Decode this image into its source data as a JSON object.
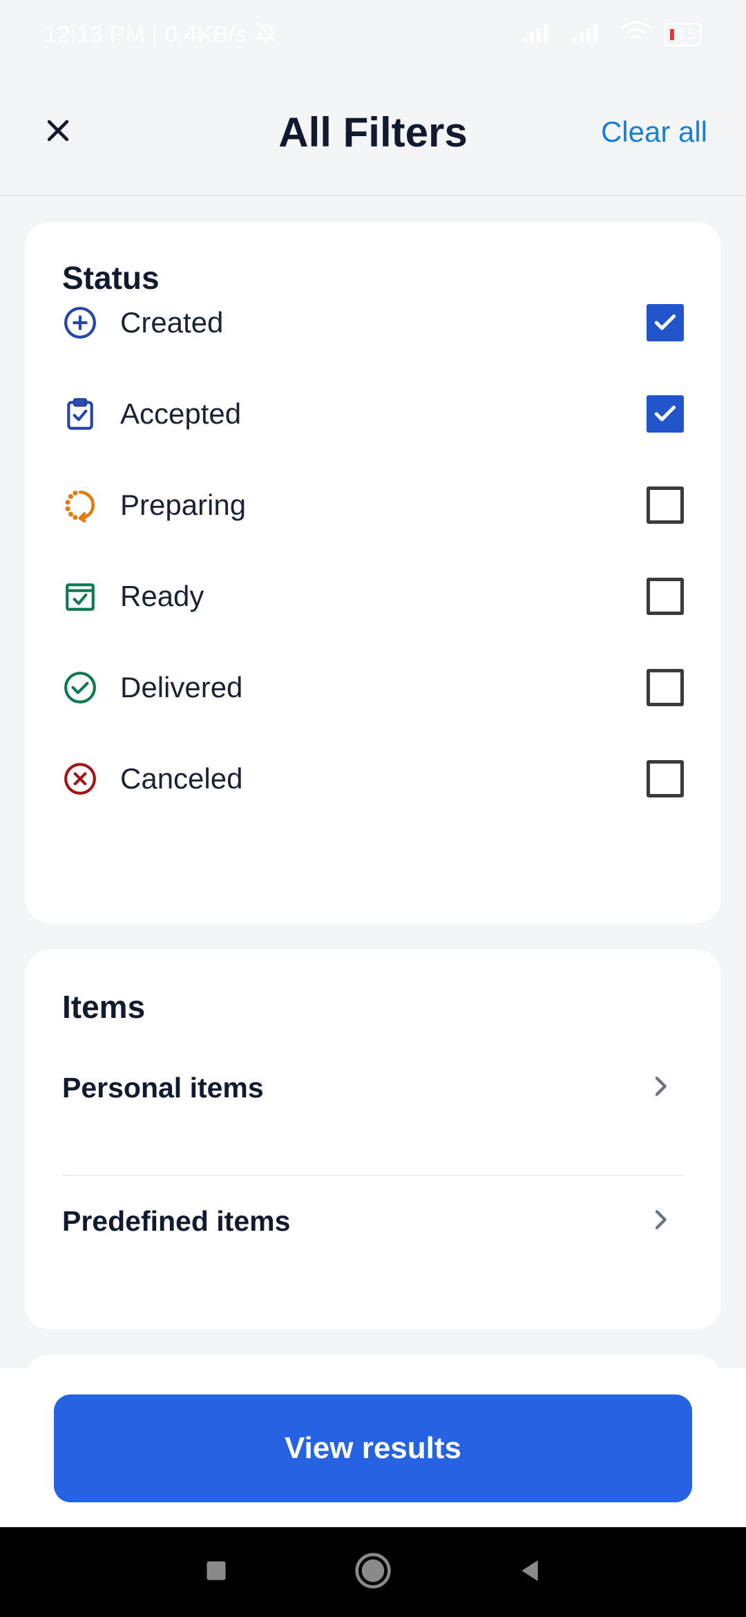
{
  "status_bar": {
    "time": "12:13 PM",
    "speed": "0.4KB/s",
    "battery": "15"
  },
  "header": {
    "title": "All Filters",
    "clear_all": "Clear all",
    "close_icon": "close-icon"
  },
  "status_section": {
    "title": "Status",
    "items": [
      {
        "label": "Created",
        "icon": "plus-circle-icon",
        "color": "#2645a8",
        "checked": true
      },
      {
        "label": "Accepted",
        "icon": "clipboard-check-icon",
        "color": "#2645a8",
        "checked": true
      },
      {
        "label": "Preparing",
        "icon": "refresh-dotted-icon",
        "color": "#e07b12",
        "checked": false
      },
      {
        "label": "Ready",
        "icon": "box-check-icon",
        "color": "#0f7a4f",
        "checked": false
      },
      {
        "label": "Delivered",
        "icon": "check-circle-icon",
        "color": "#0f7a4f",
        "checked": false
      },
      {
        "label": "Canceled",
        "icon": "x-circle-icon",
        "color": "#a31515",
        "checked": false
      }
    ]
  },
  "items_section": {
    "title": "Items",
    "rows": [
      {
        "label": "Personal items"
      },
      {
        "label": "Predefined items"
      }
    ]
  },
  "footer": {
    "button_label": "View results"
  },
  "colors": {
    "accent": "#2563e3",
    "checkbox_checked": "#2155c9",
    "link": "#1a7fd4"
  }
}
